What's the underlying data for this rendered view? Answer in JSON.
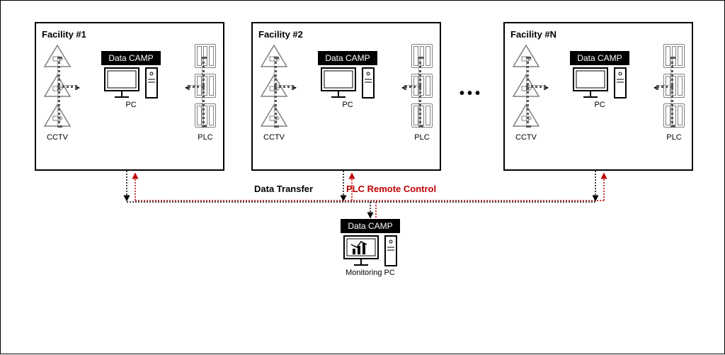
{
  "facilities": [
    {
      "title": "Facility #1",
      "badge": "Data CAMP",
      "cctv": "CCTV",
      "plc": "PLC",
      "pc": "PC"
    },
    {
      "title": "Facility #2",
      "badge": "Data CAMP",
      "cctv": "CCTV",
      "plc": "PLC",
      "pc": "PC"
    },
    {
      "title": "Facility #N",
      "badge": "Data CAMP",
      "cctv": "CCTV",
      "plc": "PLC",
      "pc": "PC"
    }
  ],
  "ellipsis": "•••",
  "labels": {
    "data_transfer": "Data Transfer",
    "plc_remote": "PLC Remote Control"
  },
  "monitor": {
    "badge": "Data CAMP",
    "label": "Monitoring PC"
  }
}
